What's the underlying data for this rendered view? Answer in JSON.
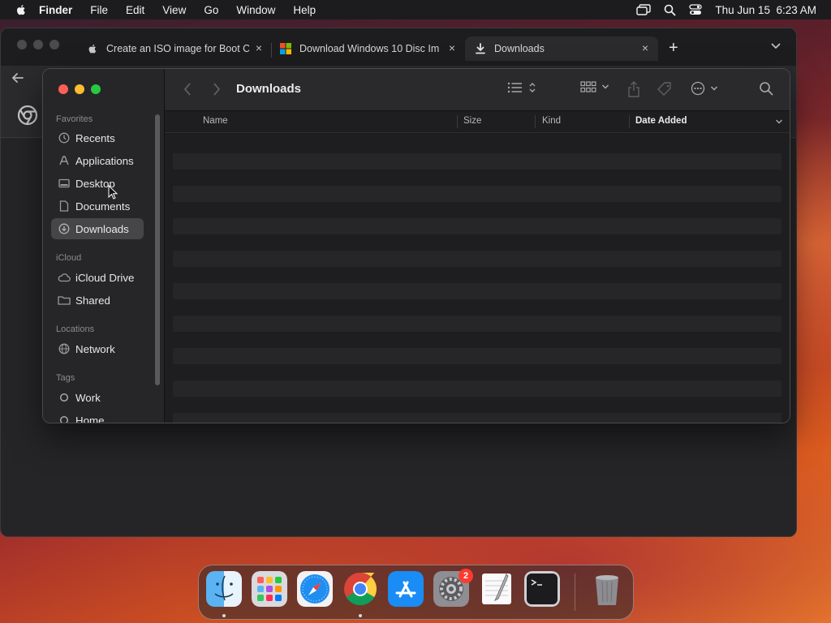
{
  "menubar": {
    "items": [
      "Finder",
      "File",
      "Edit",
      "View",
      "Go",
      "Window",
      "Help"
    ],
    "datetime": "Thu Jun 15  6:23 AM",
    "icons": [
      "apple-icon",
      "screen-mirroring-icon",
      "spotlight-search-icon",
      "control-center-icon"
    ]
  },
  "browser": {
    "tabs": [
      {
        "title": "Create an ISO image for Boot C",
        "favicon": "apple-icon"
      },
      {
        "title": "Download Windows 10 Disc Im",
        "favicon": "windows-logo-icon"
      },
      {
        "title": "Downloads",
        "favicon": "download-icon",
        "active": true
      }
    ],
    "new_tab_label": "+",
    "close_label": "×"
  },
  "finder": {
    "title": "Downloads",
    "sidebar": {
      "favorites_label": "Favorites",
      "favorites": [
        {
          "label": "Recents",
          "icon": "clock-icon"
        },
        {
          "label": "Applications",
          "icon": "applications-icon"
        },
        {
          "label": "Desktop",
          "icon": "desktop-icon"
        },
        {
          "label": "Documents",
          "icon": "document-icon"
        },
        {
          "label": "Downloads",
          "icon": "download-circle-icon",
          "selected": true
        }
      ],
      "icloud_label": "iCloud",
      "icloud": [
        {
          "label": "iCloud Drive",
          "icon": "cloud-icon"
        },
        {
          "label": "Shared",
          "icon": "shared-folder-icon"
        }
      ],
      "locations_label": "Locations",
      "locations": [
        {
          "label": "Network",
          "icon": "globe-icon"
        }
      ],
      "tags_label": "Tags",
      "tags": [
        {
          "label": "Work",
          "icon": "tag-circle-icon"
        },
        {
          "label": "Home",
          "icon": "tag-circle-icon"
        }
      ]
    },
    "columns": {
      "name": "Name",
      "size": "Size",
      "kind": "Kind",
      "date_added": "Date Added"
    },
    "sorted_column": "Date Added"
  },
  "dock": {
    "apps": [
      "Finder",
      "Launchpad",
      "Safari",
      "Google Chrome",
      "App Store",
      "System Settings",
      "TextEdit",
      "Terminal",
      "Trash"
    ],
    "settings_badge": "2"
  },
  "colors": {
    "close": "#ff5f57",
    "minimize": "#febc2e",
    "zoom": "#28c840",
    "sidebar_selected": "#464649",
    "badge": "#ff3b30"
  }
}
